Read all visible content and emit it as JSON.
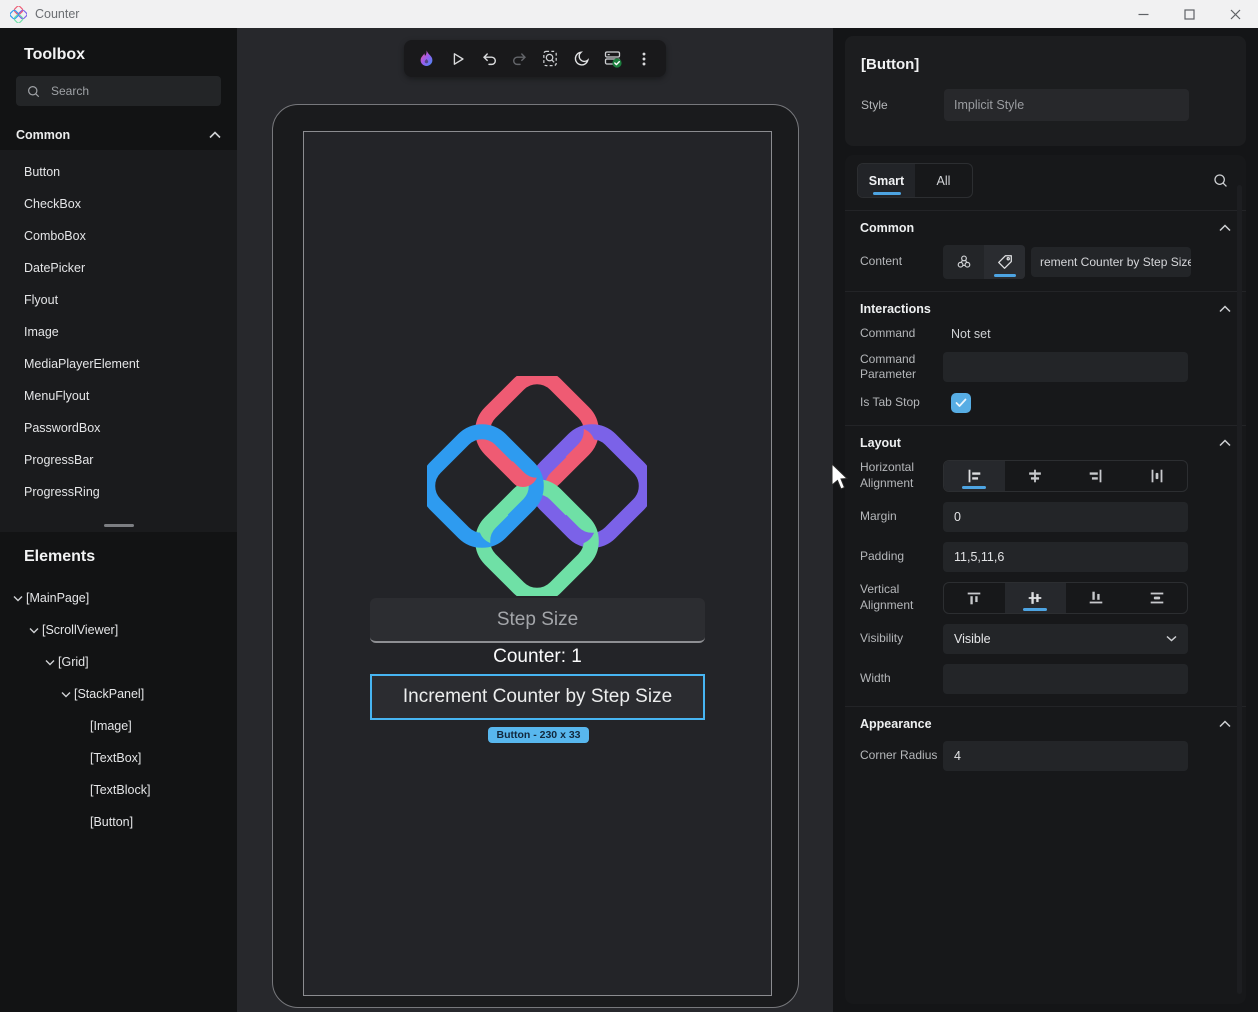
{
  "titlebar": {
    "title": "Counter"
  },
  "toolbox": {
    "title": "Toolbox",
    "search_placeholder": "Search",
    "group_title": "Common",
    "items": [
      "Button",
      "CheckBox",
      "ComboBox",
      "DatePicker",
      "Flyout",
      "Image",
      "MediaPlayerElement",
      "MenuFlyout",
      "PasswordBox",
      "ProgressBar",
      "ProgressRing"
    ]
  },
  "elements_panel": {
    "title": "Elements",
    "nodes": [
      {
        "label": "[MainPage]"
      },
      {
        "label": "[ScrollViewer]"
      },
      {
        "label": "[Grid]"
      },
      {
        "label": "[StackPanel]"
      },
      {
        "label": "[Image]"
      },
      {
        "label": "[TextBox]"
      },
      {
        "label": "[TextBlock]"
      },
      {
        "label": "[Button]"
      }
    ]
  },
  "canvas": {
    "device": {
      "step_size_placeholder": "Step Size",
      "counter_text": "Counter: 1",
      "button_label": "Increment Counter by Step Size",
      "selection_badge": "Button - 230 x 33"
    }
  },
  "inspector": {
    "selected_element": "[Button]",
    "style_label": "Style",
    "style_value": "Implicit Style",
    "tab_smart": "Smart",
    "tab_all": "All",
    "common": {
      "title": "Common",
      "content_label": "Content",
      "content_value": "rement Counter by Step Size"
    },
    "interactions": {
      "title": "Interactions",
      "command_label": "Command",
      "command_value": "Not set",
      "command_parameter_label": "Command Parameter",
      "command_parameter_value": "",
      "is_tab_stop_label": "Is Tab Stop"
    },
    "layout": {
      "title": "Layout",
      "horizontal_alignment_label": "Horizontal Alignment",
      "margin_label": "Margin",
      "margin_value": "0",
      "padding_label": "Padding",
      "padding_value": "11,5,11,6",
      "vertical_alignment_label": "Vertical Alignment",
      "visibility_label": "Visibility",
      "visibility_value": "Visible",
      "width_label": "Width",
      "width_value": ""
    },
    "appearance": {
      "title": "Appearance",
      "corner_radius_label": "Corner Radius",
      "corner_radius_value": "4"
    }
  },
  "colors": {
    "accent": "#4da4e2",
    "selection_blue": "#47b5f2",
    "badge_bg": "#58b7ee",
    "check_green": "#1d7f3f",
    "logo_red": "#ef5b73",
    "logo_blue": "#2e9bf0",
    "logo_purple": "#7b62e8",
    "logo_green": "#6fe0a6"
  }
}
